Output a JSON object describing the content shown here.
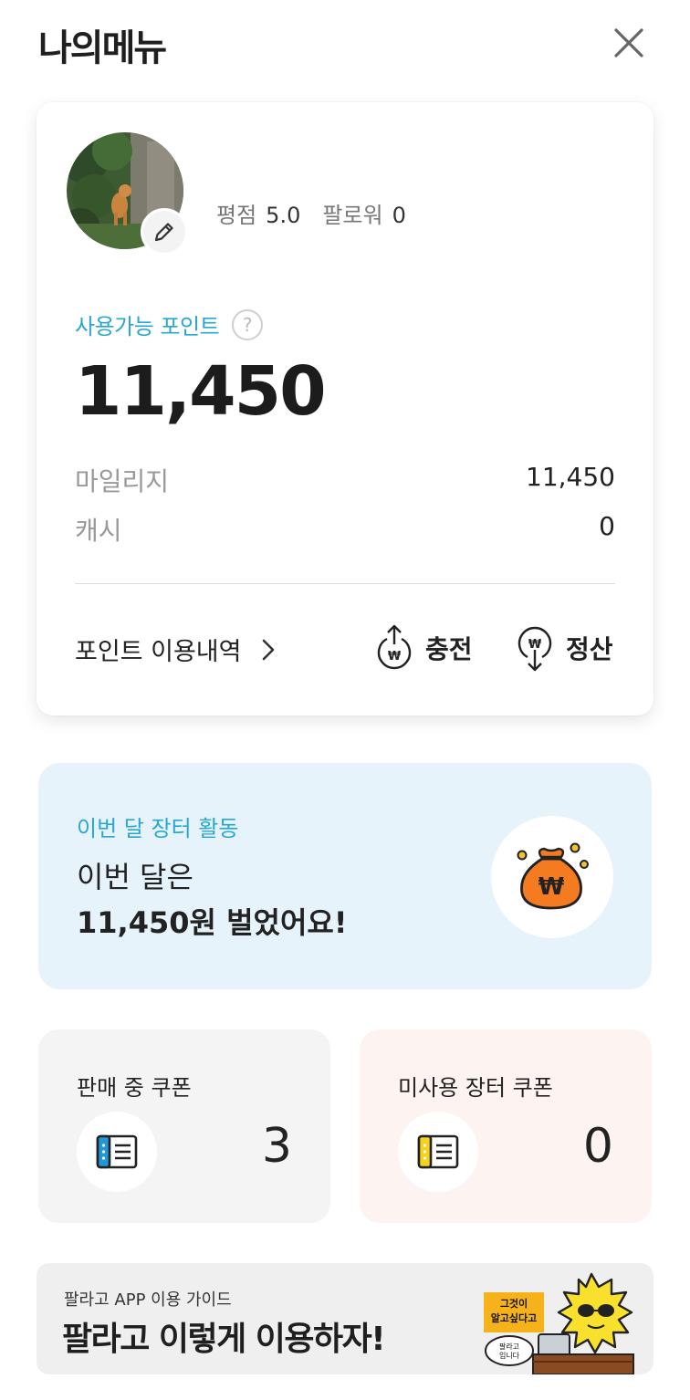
{
  "header": {
    "title": "나의메뉴"
  },
  "profile": {
    "rating_label": "평점",
    "rating_value": "5.0",
    "followers_label": "팔로워",
    "followers_value": "0"
  },
  "points": {
    "label": "사용가능 포인트",
    "help": "?",
    "total": "11,450",
    "breakdown": [
      {
        "label": "마일리지",
        "value": "11,450"
      },
      {
        "label": "캐시",
        "value": "0"
      }
    ],
    "history_label": "포인트 이용내역",
    "charge_label": "충전",
    "settle_label": "정산"
  },
  "activity": {
    "subtitle": "이번 달 장터 활동",
    "line1": "이번 달은",
    "line2": "11,450원 벌었어요!"
  },
  "coupons": {
    "selling": {
      "title": "판매 중 쿠폰",
      "count": "3",
      "accent": "#2196d8"
    },
    "unused": {
      "title": "미사용 장터 쿠폰",
      "count": "0",
      "accent": "#f6d21a"
    }
  },
  "guide": {
    "subtitle": "팔라고 APP 이용 가이드",
    "title": "팔라고 이렇게 이용하자!",
    "sticker_text": "그것이 알고싶다고",
    "bubble_text": "팔라고 입니다"
  },
  "colors": {
    "accent": "#2aa7cf",
    "activity_bg": "#e6f3fb",
    "coupon_selling_bg": "#f4f4f4",
    "coupon_unused_bg": "#fdf3f1",
    "bag": "#f47b20"
  }
}
